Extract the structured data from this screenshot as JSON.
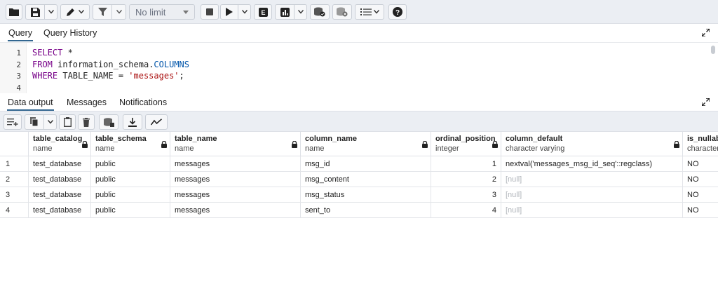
{
  "toolbar": {
    "limit_select": "No limit",
    "icons": [
      "folder-icon",
      "save-icon",
      "chevron-down-icon",
      "pen-icon",
      "filter-icon",
      "stop-icon",
      "play-icon",
      "explain-icon",
      "explain-analyze-icon",
      "commit-icon",
      "rollback-icon",
      "macros-icon",
      "help-icon"
    ]
  },
  "query_tabs": [
    "Query",
    "Query History"
  ],
  "editor": {
    "line_numbers": [
      "1",
      "2",
      "3",
      "4"
    ],
    "lines": [
      {
        "kw": "SELECT",
        "rest": " *"
      },
      {
        "kw": "FROM",
        "rest": " information_schema.",
        "col": "COLUMNS"
      },
      {
        "kw": "WHERE",
        "rest": " TABLE_NAME = ",
        "str": "'messages'",
        "tail": ";"
      }
    ]
  },
  "output_tabs": [
    "Data output",
    "Messages",
    "Notifications"
  ],
  "grid": {
    "columns": [
      {
        "name": "table_catalog",
        "type": "name"
      },
      {
        "name": "table_schema",
        "type": "name"
      },
      {
        "name": "table_name",
        "type": "name"
      },
      {
        "name": "column_name",
        "type": "name"
      },
      {
        "name": "ordinal_position",
        "type": "integer"
      },
      {
        "name": "column_default",
        "type": "character varying"
      },
      {
        "name": "is_nullable",
        "type": "character"
      }
    ],
    "rows": [
      {
        "rn": "1",
        "c": [
          "test_database",
          "public",
          "messages",
          "msg_id",
          "1",
          "nextval('messages_msg_id_seq'::regclass)",
          "NO"
        ]
      },
      {
        "rn": "2",
        "c": [
          "test_database",
          "public",
          "messages",
          "msg_content",
          "2",
          "[null]",
          "NO"
        ]
      },
      {
        "rn": "3",
        "c": [
          "test_database",
          "public",
          "messages",
          "msg_status",
          "3",
          "[null]",
          "NO"
        ]
      },
      {
        "rn": "4",
        "c": [
          "test_database",
          "public",
          "messages",
          "sent_to",
          "4",
          "[null]",
          "NO"
        ]
      }
    ]
  }
}
